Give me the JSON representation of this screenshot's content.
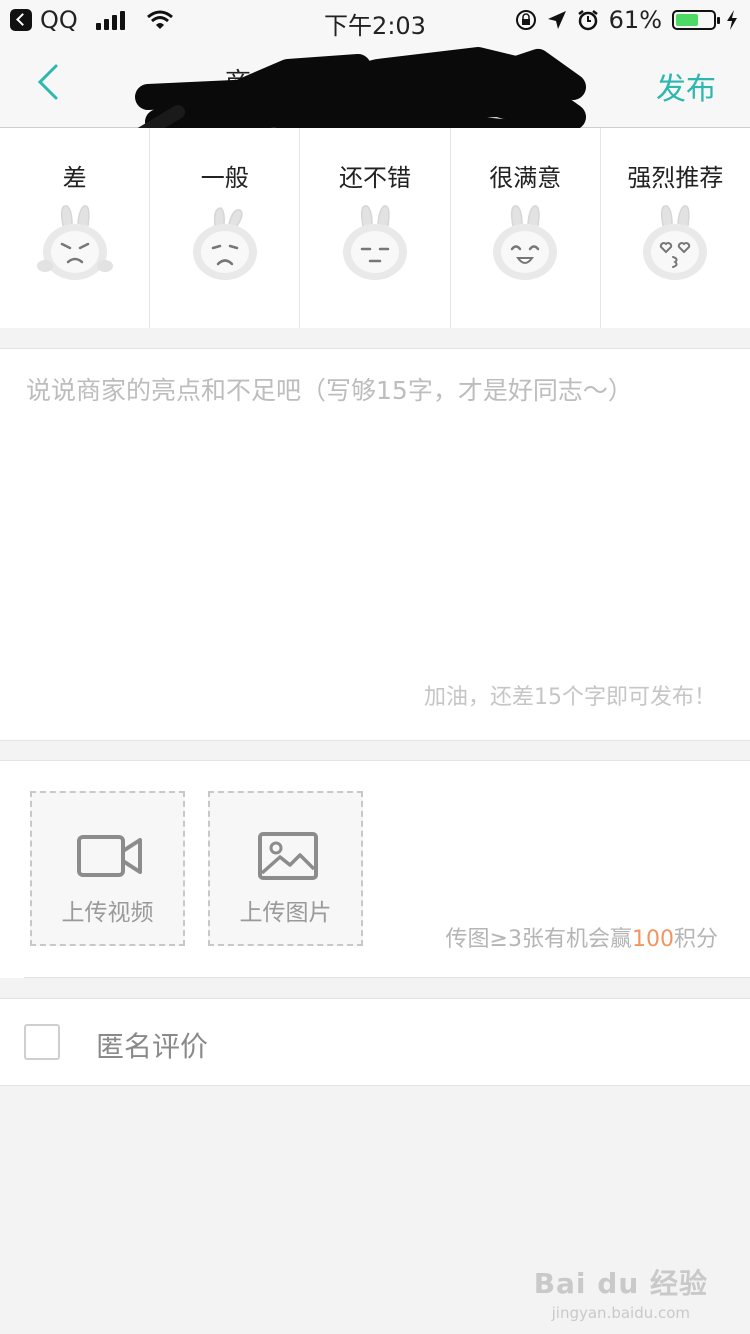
{
  "status_bar": {
    "back_app": "QQ",
    "time": "下午2:03",
    "battery": "61%",
    "battery_level": 0.61
  },
  "navbar": {
    "title": "商",
    "publish": "发布"
  },
  "ratings": [
    {
      "label": "差",
      "icon": "angry-bunny-icon"
    },
    {
      "label": "一般",
      "icon": "frowning-bunny-icon"
    },
    {
      "label": "还不错",
      "icon": "neutral-bunny-icon"
    },
    {
      "label": "很满意",
      "icon": "smiling-bunny-icon"
    },
    {
      "label": "强烈推荐",
      "icon": "heart-eyes-bunny-icon"
    }
  ],
  "review": {
    "placeholder": "说说商家的亮点和不足吧（写够15字，才是好同志～）",
    "hint": "加油，还差15个字即可发布！"
  },
  "media": {
    "upload_video": "上传视频",
    "upload_photo": "上传图片",
    "tip_prefix": "传图≥3张有机会赢",
    "tip_points": "100",
    "tip_suffix": "积分"
  },
  "anonymous": {
    "label": "匿名评价",
    "checked": false
  },
  "watermark": {
    "main": "Bai du 经验",
    "sub": "jingyan.baidu.com"
  },
  "colors": {
    "accent": "#2cb8b0",
    "points": "#f2955e",
    "battery": "#4cd964"
  }
}
